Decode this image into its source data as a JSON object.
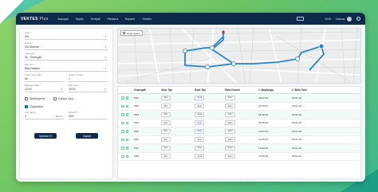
{
  "app": {
    "brand_bold": "VEKTES",
    "brand_light": "Plus",
    "nav": [
      "Anasayfa",
      "Sipariş",
      "Sevkiyat",
      "Planlama",
      "Raporlar",
      "Yönetim"
    ],
    "date": "2025",
    "user": "Kullanıcı"
  },
  "form": {
    "fields": [
      {
        "label": "Şube *",
        "value": "İZA"
      },
      {
        "label": "Müşteri *",
        "value": "İZA Ülkemiz"
      },
      {
        "label": "Güzergah *",
        "value": "İlk - Güzergah"
      },
      {
        "label": "Bitiş Yeri *",
        "value": "Bitiş Noktası"
      }
    ],
    "row1": [
      {
        "label": "Teslim Süresi (dk)",
        "value": "60"
      },
      {
        "label": "Toplam Yol (km)",
        "value": "1"
      }
    ],
    "row2": [
      {
        "label": "Başlangıç Saati *",
        "value": "10:00"
      },
      {
        "label": "Bitiş Saati *",
        "value": "18:00"
      }
    ],
    "checks": [
      {
        "label": "Bilinmeyenler",
        "on": false
      },
      {
        "label": "Rotasız Varış",
        "on": false
      }
    ],
    "special_check": {
      "label": "Yoğunluklar",
      "on": true
    },
    "row3": [
      {
        "label": "Araç Sayısı",
        "value": "4"
      },
      {
        "label": "Doluluk %",
        "value": "90%"
      }
    ],
    "stepper_suffix": "100",
    "buttons": {
      "left": "Optimize Et",
      "right": "Kaydet"
    }
  },
  "map": {
    "label": "Tümü Göster"
  },
  "table": {
    "headers": [
      "",
      "Güzergah",
      "Araç Tipi",
      "Rota Tipi",
      "Rota Durum",
      "1. Başlangıç",
      "2. Bitiş Süre"
    ],
    "rows": [
      {
        "code": "PR1",
        "a": "Mini",
        "b": "Rota",
        "c": "Sabit",
        "t1": "09:00:00",
        "t2": "00:01:48"
      },
      {
        "code": "PR2",
        "a": "Mini",
        "b": "Rota",
        "c": "Sabit",
        "t1": "09:15:00",
        "t2": "00:01:49"
      },
      {
        "code": "PR3",
        "a": "Mini",
        "b": "Rota",
        "c": "Sabit",
        "t1": "09:30:00",
        "t2": "00:02:40"
      },
      {
        "code": "PR4",
        "a": "Mini",
        "b": "Rota",
        "c": "Sabit",
        "t1": "09:45:00",
        "t2": "00:01:48"
      },
      {
        "code": "PR5",
        "a": "Mini",
        "b": "Rota",
        "c": "Sabit",
        "t1": "10:00:00",
        "t2": "00:02:48"
      },
      {
        "code": "PR6",
        "a": "Mini",
        "b": "Rota",
        "c": "Sabit",
        "t1": "10:15:00",
        "t2": "00:01:49"
      },
      {
        "code": "PR7",
        "a": "Mini",
        "b": "Rota",
        "c": "Sabit",
        "t1": "10:30:00",
        "t2": "00:02:40"
      },
      {
        "code": "PR8",
        "a": "Mini",
        "b": "Rota",
        "c": "Sabit",
        "t1": "10:45:00",
        "t2": "00:02:40"
      }
    ]
  },
  "colors": {
    "navy": "#0e2a4a",
    "route": "#2a86c8",
    "accent_green": "#6cc462",
    "teal": "#2fb394"
  }
}
